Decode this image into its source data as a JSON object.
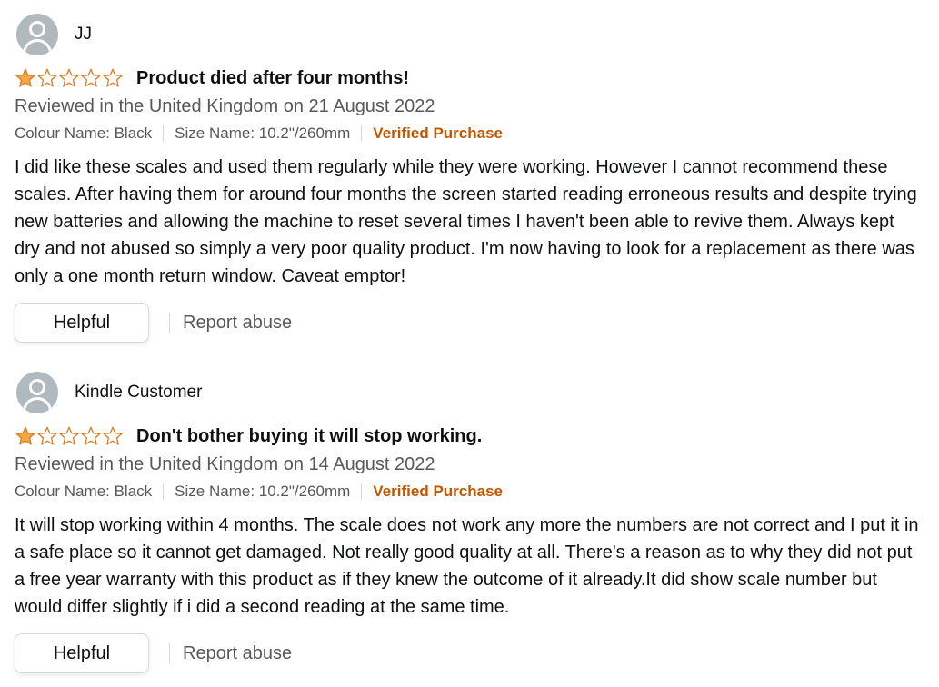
{
  "colors": {
    "star_fill": "#f3a847",
    "star_outline": "#de7921",
    "verified": "#c45500",
    "muted_text": "#565959",
    "primary_text": "#0f1111"
  },
  "reviews": [
    {
      "reviewer": "JJ",
      "avatar_icon": "default-profile-avatar",
      "rating": 1,
      "max_rating": 5,
      "title": "Product died after four months!",
      "date_line": "Reviewed in the United Kingdom on 21 August 2022",
      "colour": "Colour Name: Black",
      "size": "Size Name: 10.2\"/260mm",
      "verified": "Verified Purchase",
      "body": "I did like these scales and used them regularly while they were working. However I cannot recommend these scales. After having them for around four months the screen started reading erroneous results and despite trying new batteries and allowing the machine to reset several times I haven't been able to revive them. Always kept dry and not abused so simply a very poor quality product. I'm now having to look for a replacement as there was only a one month return window. Caveat emptor!",
      "helpful_label": "Helpful",
      "report_label": "Report abuse"
    },
    {
      "reviewer": "Kindle Customer",
      "avatar_icon": "default-profile-avatar",
      "rating": 1,
      "max_rating": 5,
      "title": "Don't bother buying it will stop working.",
      "date_line": "Reviewed in the United Kingdom on 14 August 2022",
      "colour": "Colour Name: Black",
      "size": "Size Name: 10.2\"/260mm",
      "verified": "Verified Purchase",
      "body": "It will stop working within 4 months. The scale does not work any more the numbers are not correct and I put it in a safe place so it cannot get damaged. Not really good quality at all. There's a reason as to why they did not put a free year warranty with this product as if they knew the outcome of it already.It did show scale number but would differ slightly if i did a second reading at the same time.",
      "helpful_label": "Helpful",
      "report_label": "Report abuse"
    }
  ]
}
